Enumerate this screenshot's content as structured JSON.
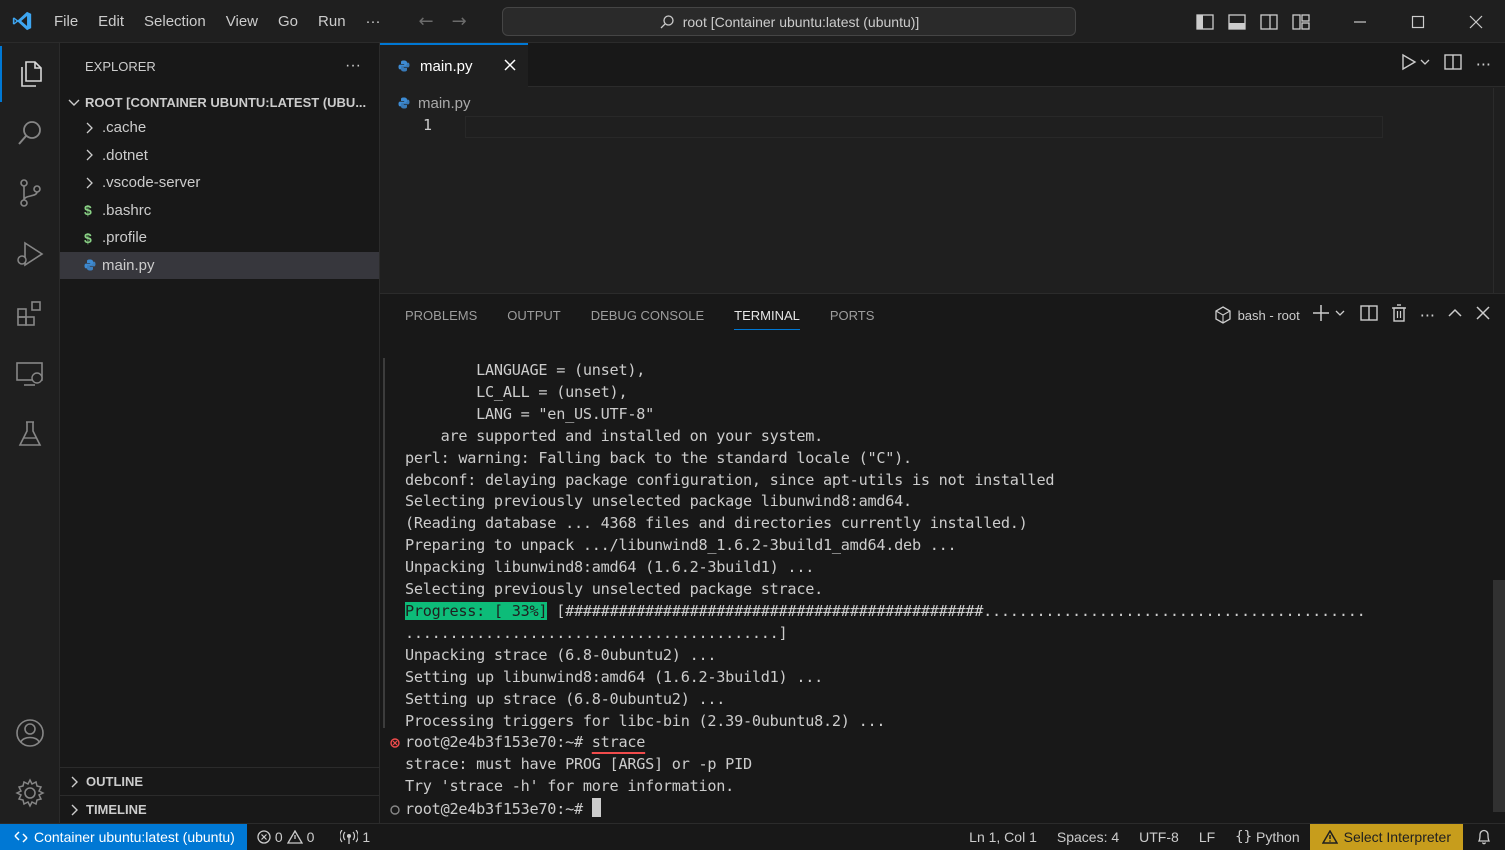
{
  "menu": [
    "File",
    "Edit",
    "Selection",
    "View",
    "Go",
    "Run",
    "···"
  ],
  "command_center": "root [Container ubuntu:latest (ubuntu)]",
  "explorer": {
    "header": "EXPLORER",
    "more": "···",
    "root": "ROOT [CONTAINER UBUNTU:LATEST (UBU...",
    "items": [
      {
        "label": ".cache",
        "kind": "folder"
      },
      {
        "label": ".dotnet",
        "kind": "folder"
      },
      {
        "label": ".vscode-server",
        "kind": "folder"
      },
      {
        "label": ".bashrc",
        "kind": "shell"
      },
      {
        "label": ".profile",
        "kind": "shell"
      },
      {
        "label": "main.py",
        "kind": "python"
      }
    ],
    "outline": "OUTLINE",
    "timeline": "TIMELINE"
  },
  "editor": {
    "tab": "main.py",
    "breadcrumb": "main.py",
    "line_number": "1"
  },
  "panel": {
    "tabs": [
      "PROBLEMS",
      "OUTPUT",
      "DEBUG CONSOLE",
      "TERMINAL",
      "PORTS"
    ],
    "active_tab": "TERMINAL",
    "terminal_name": "bash - root",
    "more": "···",
    "lines": {
      "l1": "        LANGUAGE = (unset),",
      "l2": "        LC_ALL = (unset),",
      "l3": "        LANG = \"en_US.UTF-8\"",
      "l4": "    are supported and installed on your system.",
      "l5": "perl: warning: Falling back to the standard locale (\"C\").",
      "l6": "debconf: delaying package configuration, since apt-utils is not installed",
      "l7": "Selecting previously unselected package libunwind8:amd64.",
      "l8": "(Reading database ... 4368 files and directories currently installed.)",
      "l9": "Preparing to unpack .../libunwind8_1.6.2-3build1_amd64.deb ...",
      "l10": "Unpacking libunwind8:amd64 (1.6.2-3build1) ...",
      "l11": "Selecting previously unselected package strace.",
      "progress_label": "Progress: [ 33%]",
      "progress_bar": " [###############################################...........................................",
      "progress_bar2": "..........................................]",
      "l14": "Unpacking strace (6.8-0ubuntu2) ...",
      "l15": "Setting up libunwind8:amd64 (1.6.2-3build1) ...",
      "l16": "Setting up strace (6.8-0ubuntu2) ...",
      "l17": "Processing triggers for libc-bin (2.39-0ubuntu8.2) ...",
      "prompt1": "root@2e4b3f153e70:~# ",
      "cmd1": "strace",
      "l19": "strace: must have PROG [ARGS] or -p PID",
      "l20": "Try 'strace -h' for more information.",
      "prompt2": "root@2e4b3f153e70:~# "
    }
  },
  "status": {
    "remote": "Container ubuntu:latest (ubuntu)",
    "errors": "0",
    "warnings": "0",
    "ports": "1",
    "position": "Ln 1, Col 1",
    "spaces": "Spaces: 4",
    "encoding": "UTF-8",
    "eol": "LF",
    "language": "Python",
    "interpreter": "Select Interpreter"
  },
  "colors": {
    "accent": "#0078d4",
    "progress": "#0dbc79",
    "warning_bg": "#c79d1c",
    "error": "#f14c4c"
  }
}
